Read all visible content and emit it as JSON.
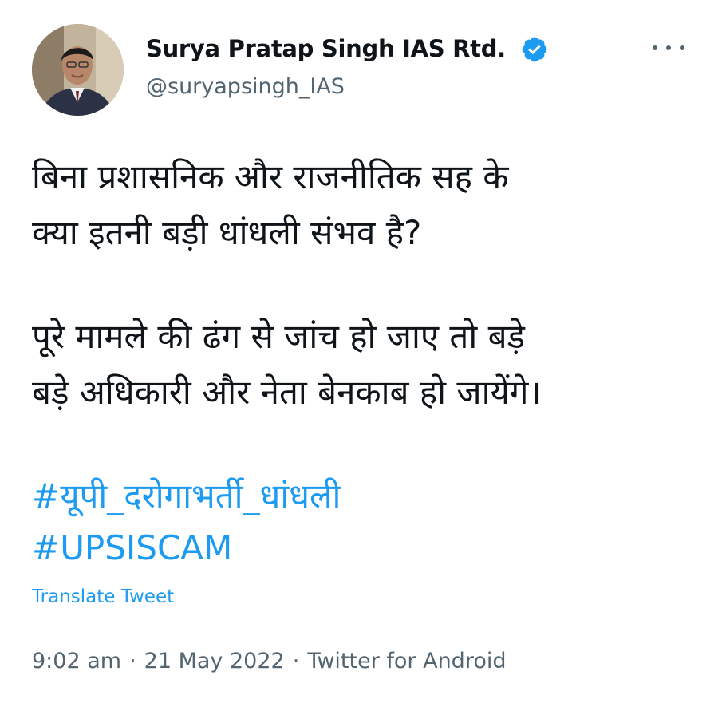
{
  "author": {
    "display_name": "Surya Pratap Singh IAS Rtd.",
    "handle": "@suryapsingh_IAS",
    "verified_icon": "verified-badge-icon",
    "verified_color": "#1d9bf0"
  },
  "tweet": {
    "lines": [
      "बिना प्रशासनिक और राजनीतिक सह के",
      "क्या इतनी बड़ी धांधली संभव है?",
      "पूरे मामले की ढंग से जांच हो जाए तो बड़े",
      "बड़े अधिकारी और नेता बेनकाब हो जायेंगे।"
    ],
    "hashtags": [
      "#यूपी_दरोगाभर्ती_धांधली",
      "#UPSISCAM"
    ],
    "translate_label": "Translate Tweet"
  },
  "meta": {
    "time": "9:02 am",
    "separator": "·",
    "date": "21 May 2022",
    "source": "Twitter for Android"
  },
  "colors": {
    "link": "#1d9bf0",
    "secondary_text": "#536471",
    "primary_text": "#0f1419"
  }
}
